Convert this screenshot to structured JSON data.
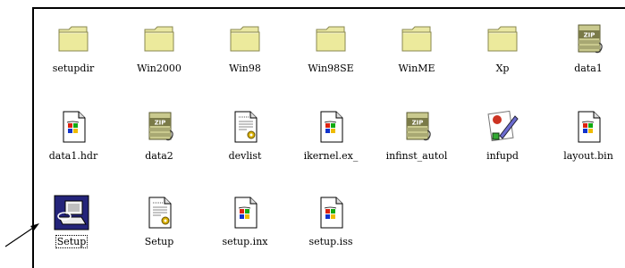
{
  "window": {
    "selected_item": "Setup"
  },
  "files": {
    "setupdir": {
      "label": "setupdir",
      "icon": "folder-icon"
    },
    "win2000": {
      "label": "Win2000",
      "icon": "folder-icon"
    },
    "win98": {
      "label": "Win98",
      "icon": "folder-icon"
    },
    "win98se": {
      "label": "Win98SE",
      "icon": "folder-icon"
    },
    "winme": {
      "label": "WinME",
      "icon": "folder-icon"
    },
    "xp": {
      "label": "Xp",
      "icon": "folder-icon"
    },
    "data1": {
      "label": "data1",
      "icon": "zip-cabinet-icon"
    },
    "data1_hdr": {
      "label": "data1.hdr",
      "icon": "generic-file-icon"
    },
    "data2": {
      "label": "data2",
      "icon": "zip-cabinet-icon"
    },
    "devlist": {
      "label": "devlist",
      "icon": "config-file-icon"
    },
    "ikernel": {
      "label": "ikernel.ex_",
      "icon": "generic-file-icon"
    },
    "infinst": {
      "label": "infinst_autol",
      "icon": "zip-cabinet-icon"
    },
    "infupd": {
      "label": "infupd",
      "icon": "infupd-app-icon"
    },
    "layout_bin": {
      "label": "layout.bin",
      "icon": "generic-file-icon"
    },
    "setup_exe": {
      "label": "Setup",
      "icon": "setup-computer-icon"
    },
    "setup_ini": {
      "label": "Setup",
      "icon": "config-file-icon"
    },
    "setup_inx": {
      "label": "setup.inx",
      "icon": "generic-file-icon"
    },
    "setup_iss": {
      "label": "setup.iss",
      "icon": "generic-file-icon"
    }
  },
  "colors": {
    "folder": "#e9e7a2",
    "folder_stroke": "#8a8850",
    "zip_band": "#a8a873",
    "setup_bg": "#24247a"
  }
}
